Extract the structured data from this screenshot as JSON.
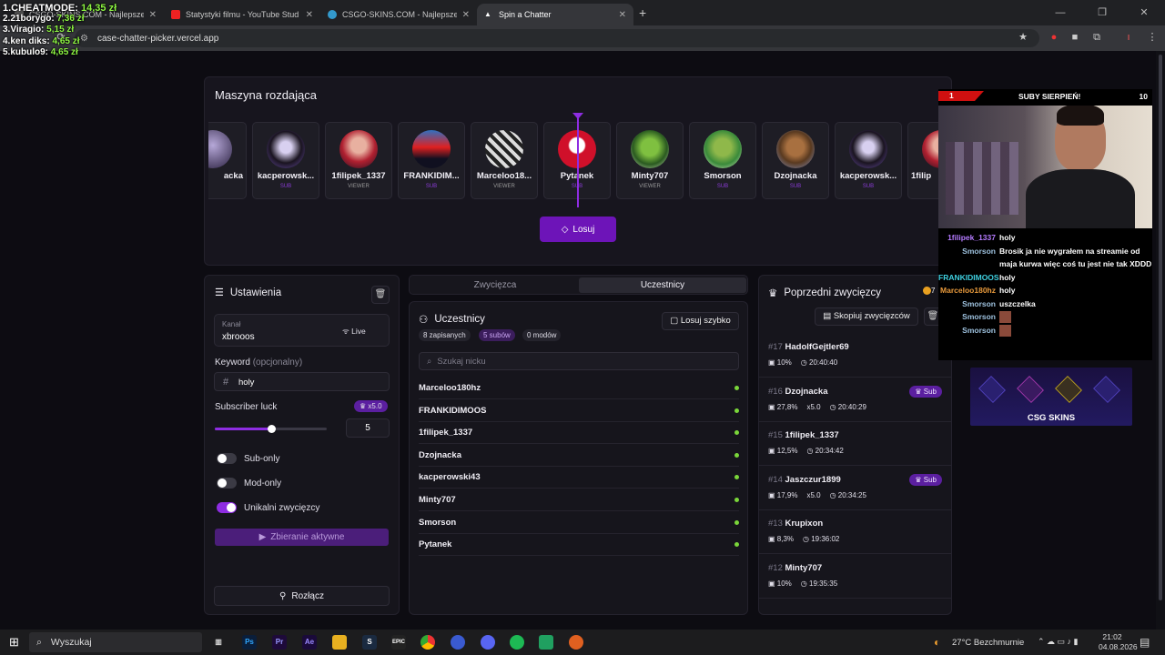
{
  "overlay": {
    "l1": "1.CHEATMODE:",
    "a1": "14,35 zł",
    "l2": "2.21borygo:",
    "a2": "7,36 zł",
    "l3": "3.Viragio:",
    "a3": "5,15 zł",
    "l4": "4.ken diks:",
    "a4": "4,65 zł",
    "l5": "5.kubulo9:",
    "a5": "4,65 zł"
  },
  "browser": {
    "tabs": [
      "CSGO-SKINS.COM - Najlepsze",
      "Statystyki filmu - YouTube Stud",
      "CSGO-SKINS.COM - Najlepsze",
      "Spin a Chatter"
    ],
    "url": "case-chatter-picker.vercel.app"
  },
  "machine": {
    "title": "Maszyna rozdająca",
    "button": "Losuj",
    "cards": [
      {
        "name": "acka",
        "tag": ""
      },
      {
        "name": "kacperowsk...",
        "tag": "SUB"
      },
      {
        "name": "1filipek_1337",
        "tag": "VIEWER"
      },
      {
        "name": "FRANKIDIM...",
        "tag": "SUB"
      },
      {
        "name": "Marceloo18...",
        "tag": "VIEWER"
      },
      {
        "name": "Pytanek",
        "tag": "SUB"
      },
      {
        "name": "Minty707",
        "tag": "VIEWER"
      },
      {
        "name": "Smorson",
        "tag": "SUB"
      },
      {
        "name": "Dzojnacka",
        "tag": "SUB"
      },
      {
        "name": "kacperowsk...",
        "tag": "SUB"
      },
      {
        "name": "1filip",
        "tag": ""
      }
    ]
  },
  "settings": {
    "title": "Ustawienia",
    "kanal_label": "Kanał",
    "kanal_value": "xbrooos",
    "live": "Live",
    "keyword_label": "Keyword",
    "keyword_opt": "(opcjonalny)",
    "keyword_value": "holy",
    "luck_label": "Subscriber luck",
    "luck_badge": "x5.0",
    "luck_value": "5",
    "luck_fraction": 0.5,
    "sub_only": "Sub-only",
    "mod_only": "Mod-only",
    "unique": "Unikalni zwycięzcy",
    "collect": "Zbieranie aktywne",
    "disconnect": "Rozłącz"
  },
  "tabs": {
    "winner": "Zwycięzca",
    "participants": "Uczestnicy"
  },
  "participants": {
    "title": "Uczestnicy",
    "quick": "Losuj szybko",
    "saved": "8 zapisanych",
    "subs": "5 subów",
    "mods": "0 modów",
    "search_placeholder": "Szukaj nicku",
    "list": [
      "Marceloo180hz",
      "FRANKIDIMOOS",
      "1filipek_1337",
      "Dzojnacka",
      "kacperowski43",
      "Minty707",
      "Smorson",
      "Pytanek"
    ]
  },
  "previous": {
    "title": "Poprzedni zwycięzcy",
    "copy": "Skopiuj zwycięzców",
    "badge": "7",
    "rows": [
      {
        "num": "#17",
        "name": "HadolfGejtler69",
        "pct": "10%",
        "mult": "",
        "time": "20:40:40",
        "sub": ""
      },
      {
        "num": "#16",
        "name": "Dzojnacka",
        "pct": "27,8%",
        "mult": "x5.0",
        "time": "20:40:29",
        "sub": "Sub"
      },
      {
        "num": "#15",
        "name": "1filipek_1337",
        "pct": "12,5%",
        "mult": "",
        "time": "20:34:42",
        "sub": ""
      },
      {
        "num": "#14",
        "name": "Jaszczur1899",
        "pct": "17,9%",
        "mult": "x5.0",
        "time": "20:34:25",
        "sub": "Sub"
      },
      {
        "num": "#13",
        "name": "Krupixon",
        "pct": "8,3%",
        "mult": "",
        "time": "19:36:02",
        "sub": ""
      },
      {
        "num": "#12",
        "name": "Minty707",
        "pct": "10%",
        "mult": "",
        "time": "19:35:35",
        "sub": ""
      }
    ]
  },
  "stream": {
    "num_left": "1",
    "header": "SUBY SIERPIEŃ!",
    "num_right": "10",
    "chat": [
      {
        "user": "1filipek_1337",
        "msg": "holy",
        "color": "#b57bff"
      },
      {
        "user": "Smorson",
        "msg": "Brosik ja nie wygrałem na streamie od maja kurwa więc coś tu jest nie tak XDDD",
        "color": "#9fc3e0"
      },
      {
        "user": "FRANKIDIMOOS",
        "msg": "holy",
        "color": "#3fd0e0"
      },
      {
        "user": "Marceloo180hz",
        "msg": "holy",
        "color": "#e89a3c"
      },
      {
        "user": "Smorson",
        "msg": "uszczelka",
        "color": "#9fc3e0"
      },
      {
        "user": "Smorson",
        "msg": "",
        "color": "#9fc3e0"
      },
      {
        "user": "Smorson",
        "msg": "",
        "color": "#9fc3e0"
      }
    ],
    "banner": "CSG SKINS"
  },
  "taskbar": {
    "search": "Wyszukaj",
    "weather": "27°C  Bezchmurnie",
    "time": "21:02",
    "date": "04.08.2026"
  }
}
